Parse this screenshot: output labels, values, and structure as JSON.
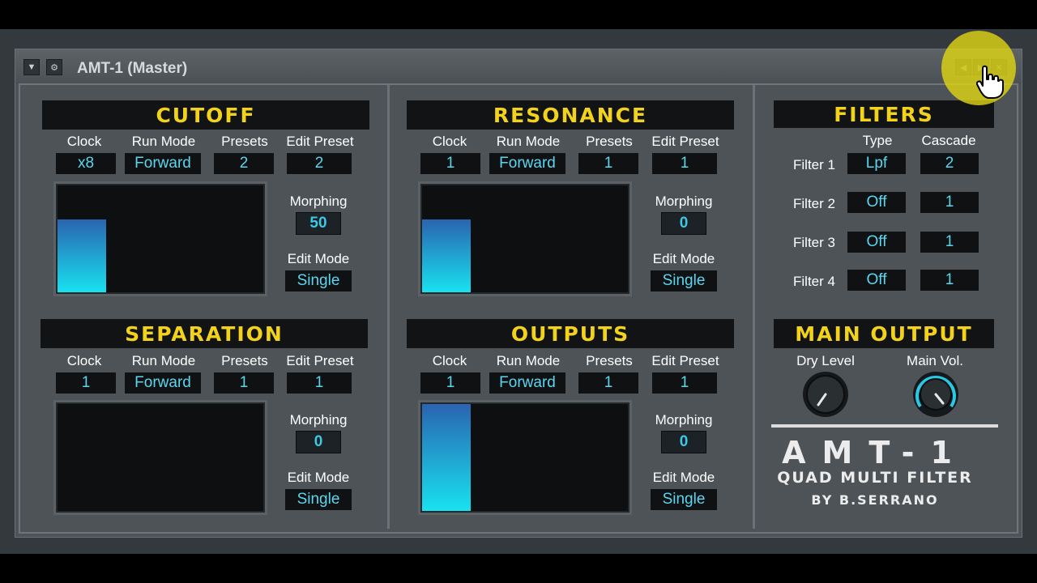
{
  "window": {
    "title": "AMT-1 (Master)"
  },
  "cutoff": {
    "header": "CUTOFF",
    "labels": {
      "clock": "Clock",
      "run_mode": "Run Mode",
      "presets": "Presets",
      "edit_preset": "Edit Preset",
      "morphing": "Morphing",
      "edit_mode": "Edit Mode"
    },
    "clock": "x8",
    "run_mode": "Forward",
    "presets": "2",
    "edit_preset": "2",
    "morphing": "50",
    "edit_mode": "Single",
    "bar_level": 0.68
  },
  "resonance": {
    "header": "RESONANCE",
    "labels": {
      "clock": "Clock",
      "run_mode": "Run Mode",
      "presets": "Presets",
      "edit_preset": "Edit Preset",
      "morphing": "Morphing",
      "edit_mode": "Edit Mode"
    },
    "clock": "1",
    "run_mode": "Forward",
    "presets": "1",
    "edit_preset": "1",
    "morphing": "0",
    "edit_mode": "Single",
    "bar_level": 0.68
  },
  "separation": {
    "header": "SEPARATION",
    "labels": {
      "clock": "Clock",
      "run_mode": "Run Mode",
      "presets": "Presets",
      "edit_preset": "Edit Preset",
      "morphing": "Morphing",
      "edit_mode": "Edit Mode"
    },
    "clock": "1",
    "run_mode": "Forward",
    "presets": "1",
    "edit_preset": "1",
    "morphing": "0",
    "edit_mode": "Single",
    "bar_level": 0
  },
  "outputs": {
    "header": "OUTPUTS",
    "labels": {
      "clock": "Clock",
      "run_mode": "Run Mode",
      "presets": "Presets",
      "edit_preset": "Edit Preset",
      "morphing": "Morphing",
      "edit_mode": "Edit Mode"
    },
    "clock": "1",
    "run_mode": "Forward",
    "presets": "1",
    "edit_preset": "1",
    "morphing": "0",
    "edit_mode": "Single",
    "bar_level": 1.0
  },
  "filters": {
    "header": "FILTERS",
    "col_type": "Type",
    "col_cascade": "Cascade",
    "rows": [
      {
        "label": "Filter 1",
        "type": "Lpf",
        "cascade": "2"
      },
      {
        "label": "Filter 2",
        "type": "Off",
        "cascade": "1"
      },
      {
        "label": "Filter 3",
        "type": "Off",
        "cascade": "1"
      },
      {
        "label": "Filter 4",
        "type": "Off",
        "cascade": "1"
      }
    ]
  },
  "main_output": {
    "header": "MAIN OUTPUT",
    "dry_level_label": "Dry Level",
    "main_vol_label": "Main Vol."
  },
  "brand": {
    "name": "AMT-1",
    "subtitle": "QUAD MULTI FILTER",
    "author": "BY B.SERRANO"
  },
  "colors": {
    "accent": "#f2d21a",
    "value": "#5ad6f0",
    "bar_top": "#2a64b0",
    "bar_bottom": "#18e2f0"
  }
}
